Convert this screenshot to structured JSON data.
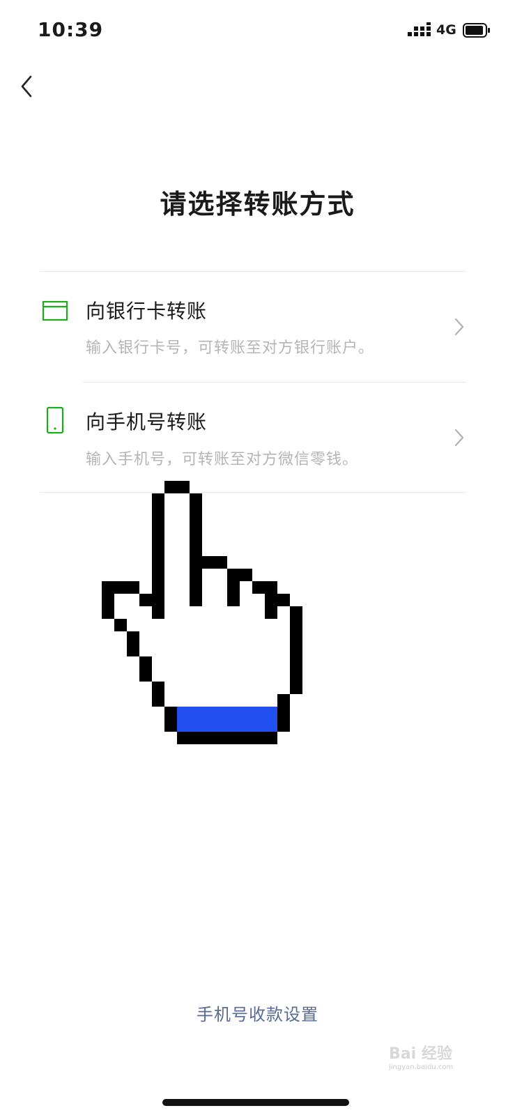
{
  "status_bar": {
    "time": "10:39",
    "network": "4G",
    "icons": [
      "signal-icon",
      "battery-icon"
    ]
  },
  "nav": {
    "back_icon": "back-chevron-icon"
  },
  "title": "请选择转账方式",
  "options": [
    {
      "icon": "bank-card-icon",
      "title": "向银行卡转账",
      "desc": "输入银行卡号，可转账至对方银行账户。",
      "chevron_icon": "chevron-right-icon"
    },
    {
      "icon": "mobile-phone-icon",
      "title": "向手机号转账",
      "desc": "输入手机号，可转账至对方微信零钱。",
      "chevron_icon": "chevron-right-icon"
    }
  ],
  "footer_link": "手机号收款设置",
  "overlay": {
    "icon": "pointing-hand-cursor-icon",
    "cuff_color": "#2250f0"
  },
  "colors": {
    "accent_green": "#1aad19",
    "link_blue": "#576b95",
    "secondary_text": "#b5b5b5"
  }
}
